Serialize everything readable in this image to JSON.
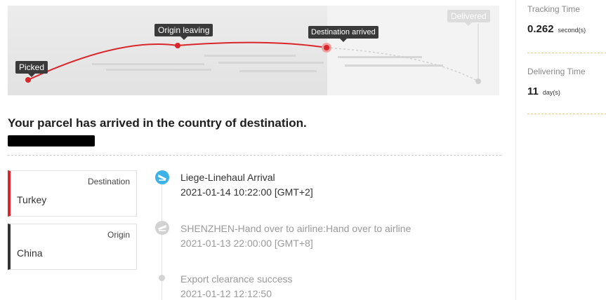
{
  "tracking": {
    "stages": {
      "picked": "Picked",
      "origin_leaving": "Origin leaving",
      "destination_arrived": "Destination arrived",
      "delivered": "Delivered"
    },
    "colors": {
      "route": "#d9262a",
      "current_pulse": "#f2a0a0",
      "pending": "#cfcfcf"
    }
  },
  "headline": "Your parcel has arrived in the country of destination.",
  "route_cards": {
    "destination": {
      "caption": "Destination",
      "value": "Turkey"
    },
    "origin": {
      "caption": "Origin",
      "value": "China"
    }
  },
  "events": [
    {
      "title": "Liege-Linehaul Arrival",
      "time": "2021-01-14 10:22:00 [GMT+2]",
      "status": "current",
      "icon": "plane-landing-icon"
    },
    {
      "title": "SHENZHEN-Hand over to airline:Hand over to airline",
      "time": "2021-01-13 22:00:00 [GMT+8]",
      "status": "past",
      "icon": "plane-takeoff-icon"
    },
    {
      "title": "Export clearance success",
      "time": "2021-01-12 12:12:50",
      "status": "past",
      "icon": "dot-icon"
    }
  ],
  "stats": {
    "tracking_time": {
      "caption": "Tracking Time",
      "value": "0.262",
      "unit": "second(s)"
    },
    "delivering_time": {
      "caption": "Delivering Time",
      "value": "11",
      "unit": "day(s)"
    }
  }
}
